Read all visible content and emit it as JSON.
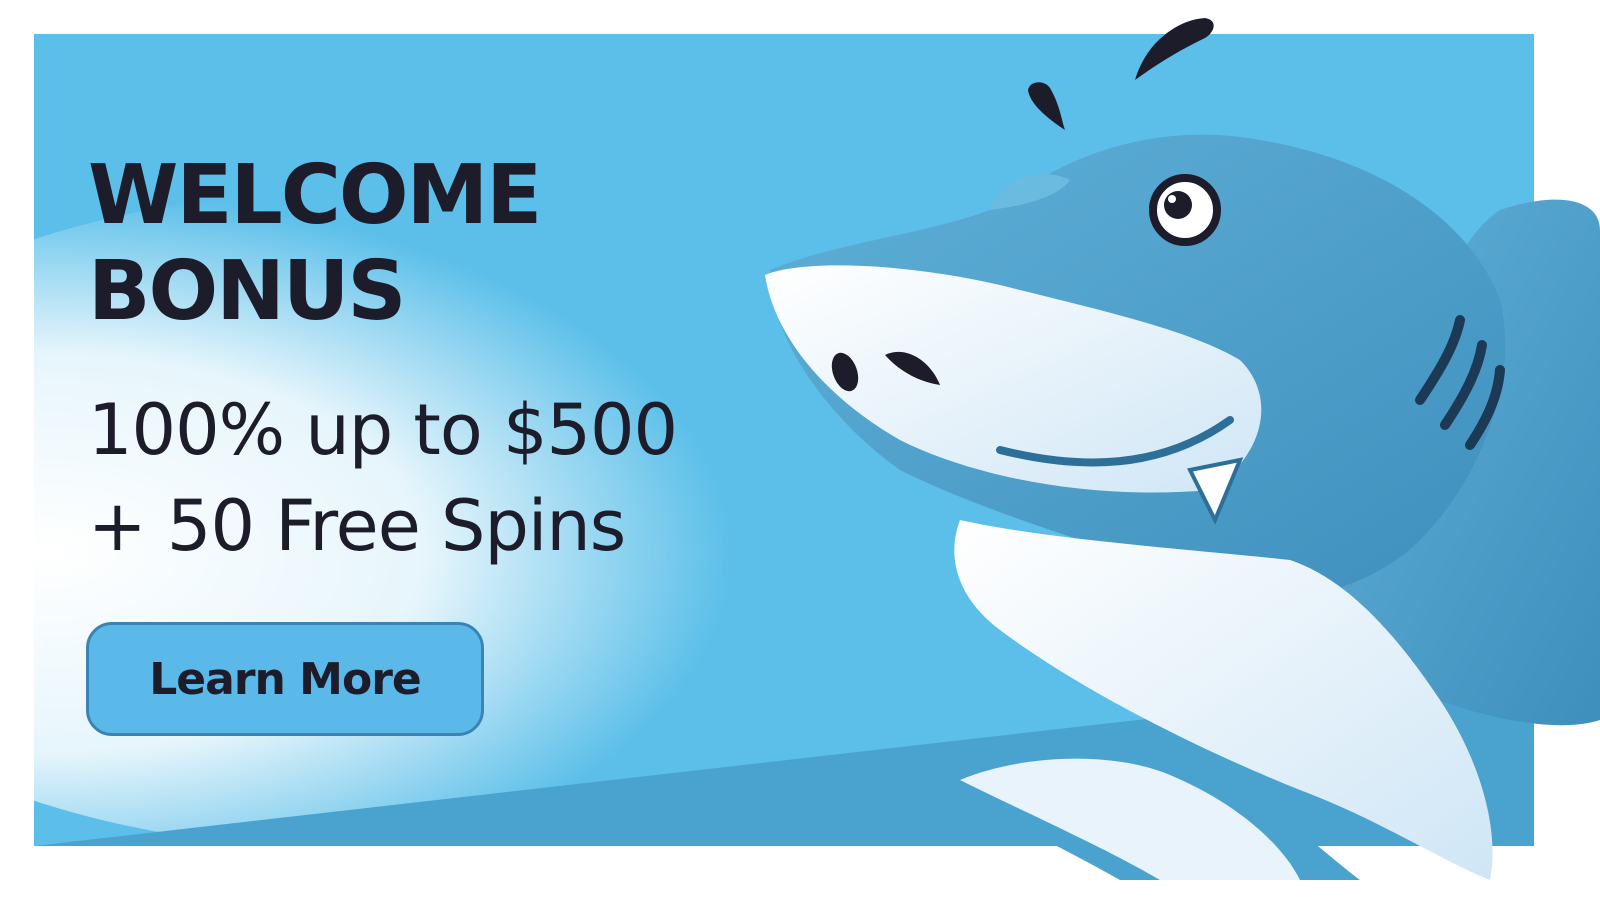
{
  "banner": {
    "headline_line1": "WELCOME",
    "headline_line2": "BONUS",
    "offer_line1": "100% up to $500",
    "offer_line2": "+ 50 Free Spins",
    "cta_label": "Learn More"
  },
  "colors": {
    "sky": "#5bbfe9",
    "shark_body": "#4a9fc8",
    "shark_belly": "#e8f3fb",
    "text": "#1c1c2b",
    "button": "#5ab9e8"
  },
  "illustration": "shark-mascot"
}
